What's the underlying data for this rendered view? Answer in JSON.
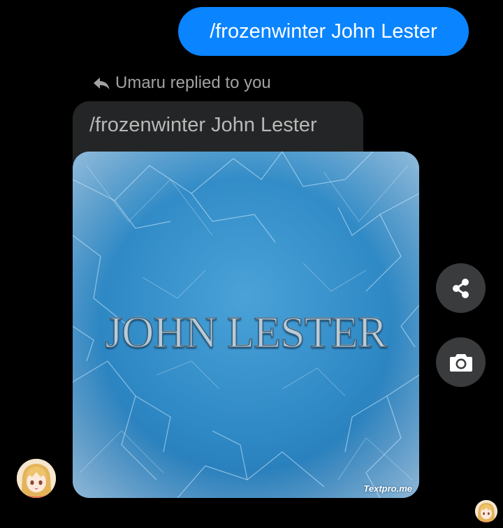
{
  "sent_message": {
    "text": "/frozenwinter John Lester"
  },
  "reply": {
    "header": "Umaru replied to you",
    "quoted_text": "/frozenwinter John Lester",
    "image": {
      "title": "JOHN LESTER",
      "watermark": "Textpro.me"
    }
  },
  "actions": {
    "share_icon": "share-icon",
    "camera_icon": "camera-icon"
  },
  "colors": {
    "sent_bubble": "#0a84ff",
    "quoted_bubble": "#242526",
    "action_button": "#3a3b3c",
    "background": "#000000"
  }
}
